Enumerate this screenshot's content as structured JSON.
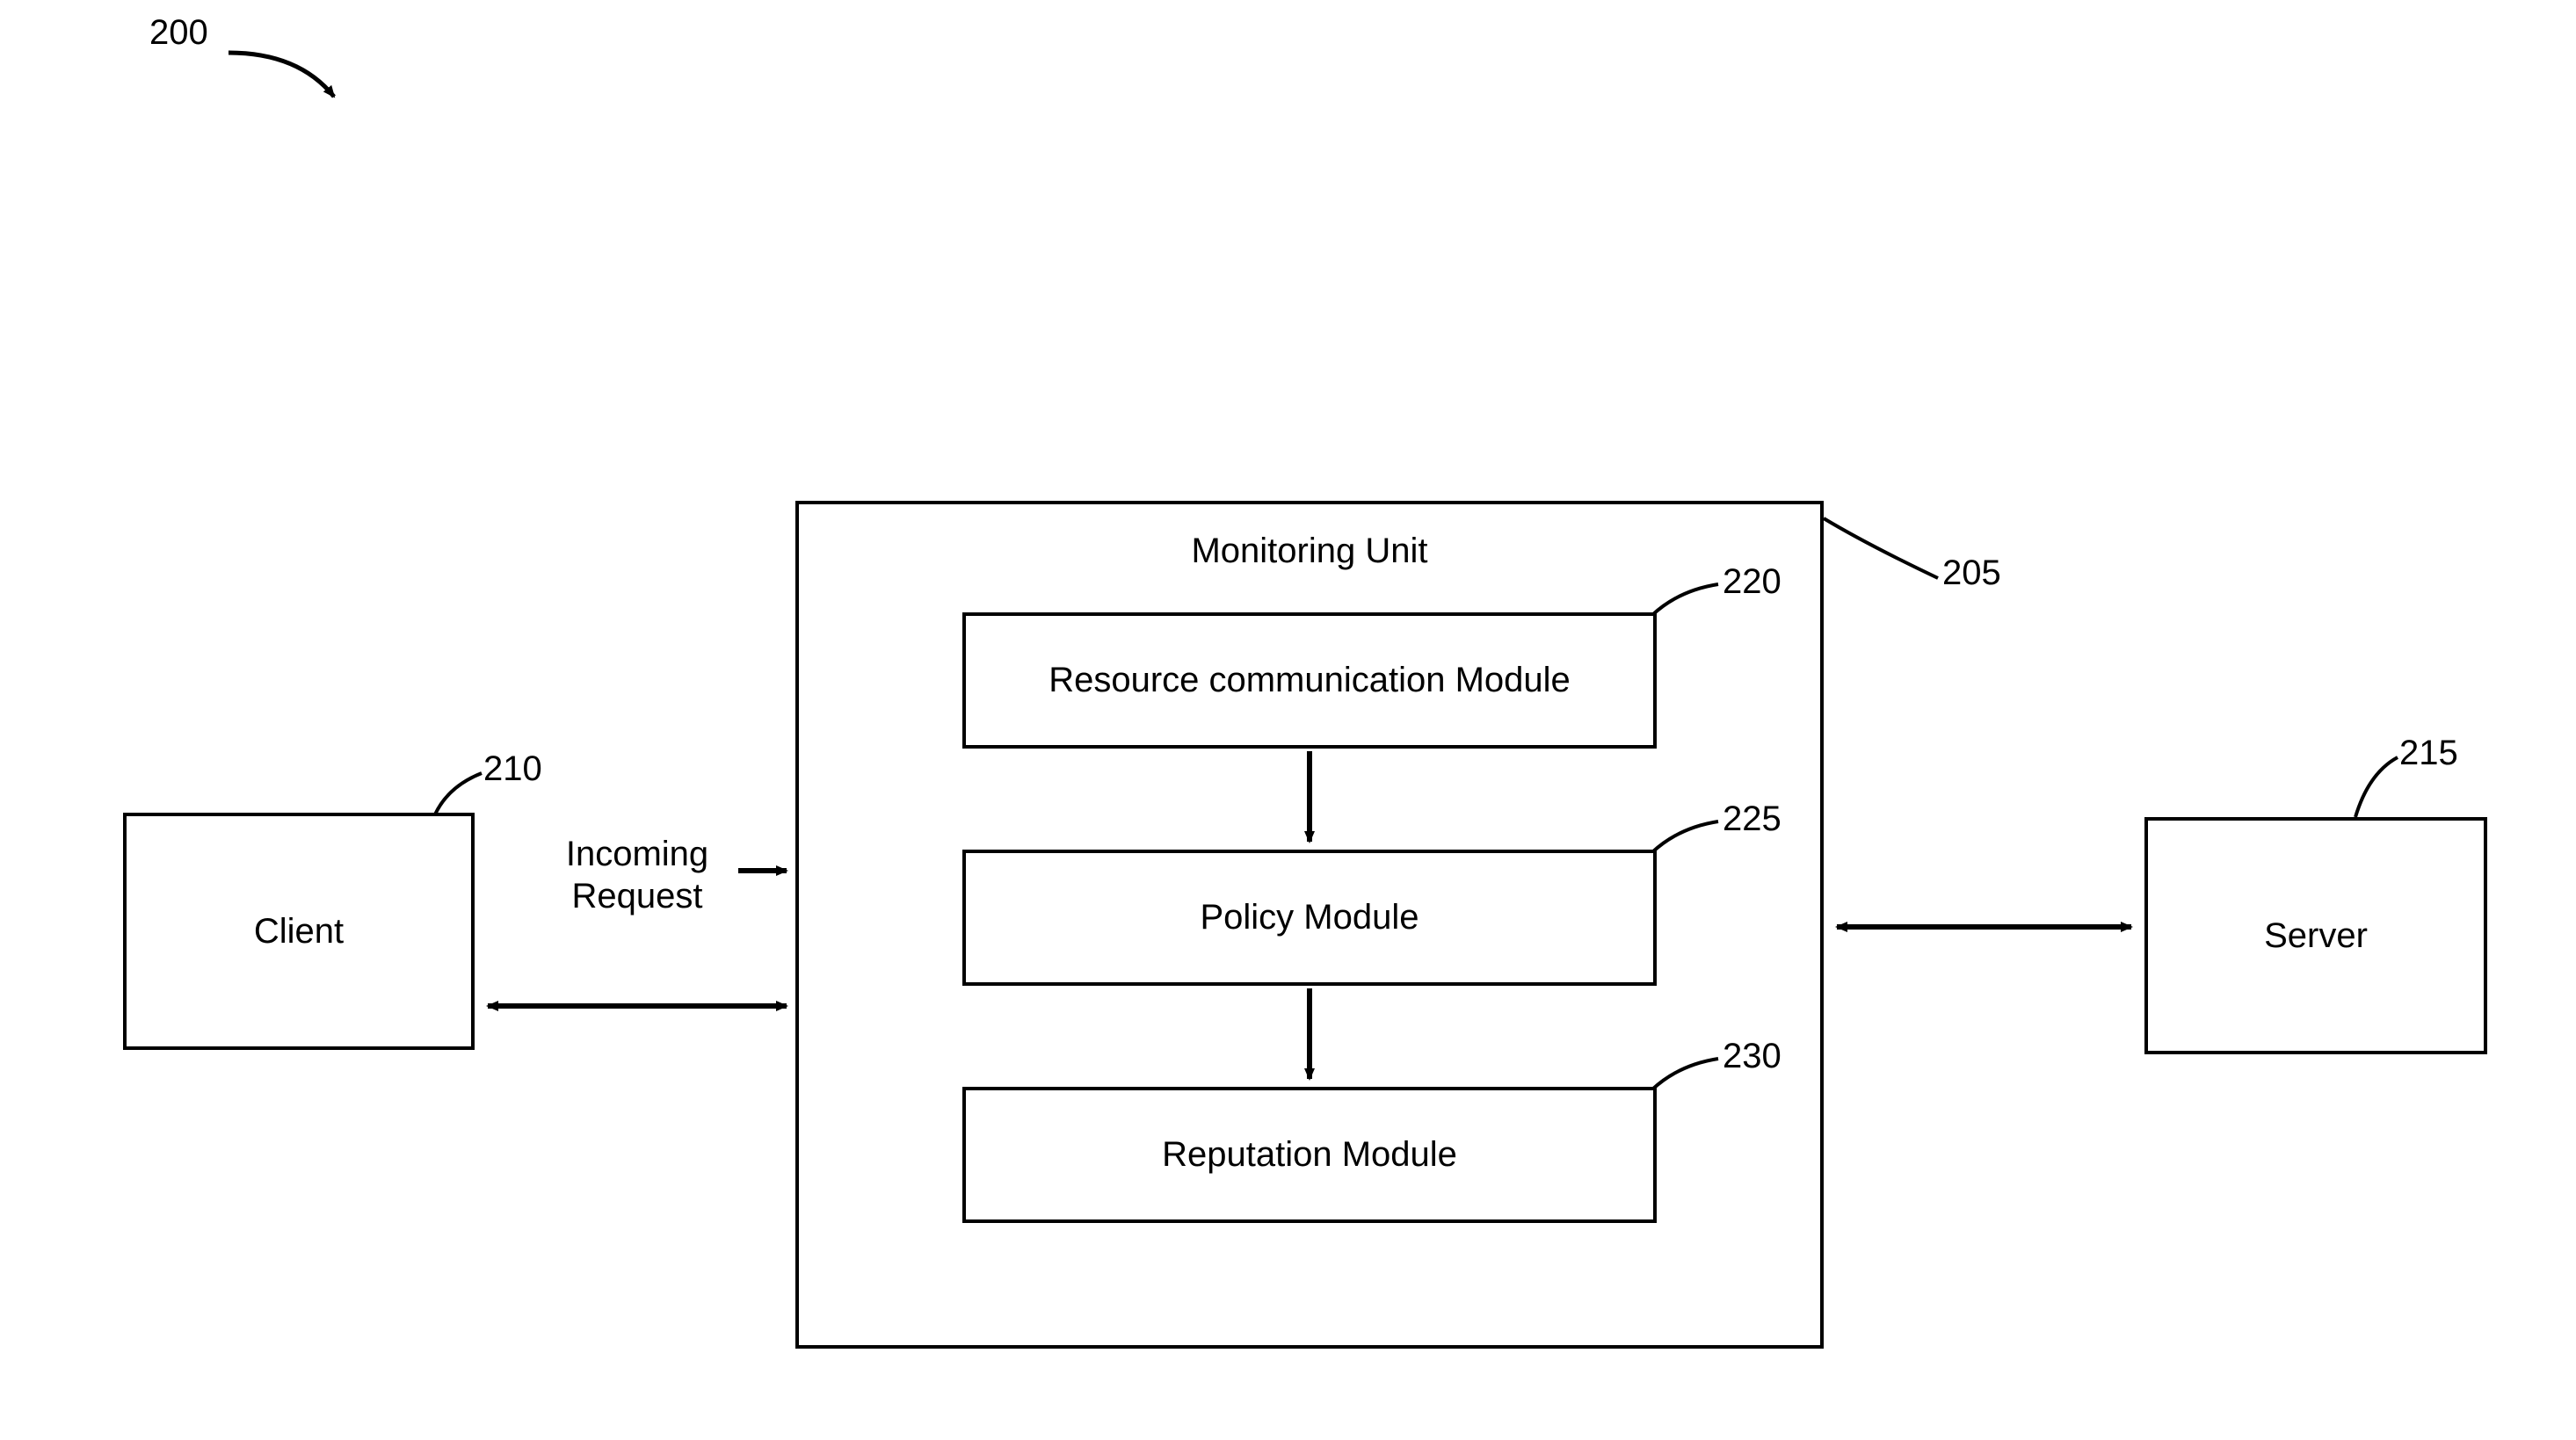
{
  "figure_ref": "200",
  "client": {
    "label": "Client",
    "ref": "210"
  },
  "server": {
    "label": "Server",
    "ref": "215"
  },
  "incoming_request": "Incoming\nRequest",
  "monitoring_unit": {
    "title": "Monitoring Unit",
    "ref": "205",
    "modules": {
      "resource": {
        "label": "Resource communication Module",
        "ref": "220"
      },
      "policy": {
        "label": "Policy Module",
        "ref": "225"
      },
      "reputation": {
        "label": "Reputation Module",
        "ref": "230"
      }
    }
  }
}
